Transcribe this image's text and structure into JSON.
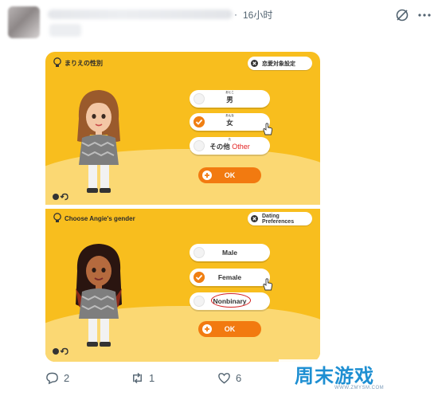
{
  "post": {
    "time_separator": "·",
    "time": "16小时"
  },
  "panel_top": {
    "title": "まりえの性別",
    "preferences_label": "恋愛対象設定",
    "options": [
      {
        "label": "男",
        "ruby": "おとこ",
        "selected": false
      },
      {
        "label": "女",
        "ruby": "おんな",
        "selected": true
      },
      {
        "label": "その他",
        "ruby": "た",
        "selected": false,
        "annotation": "Other"
      }
    ],
    "ok_label": "OK"
  },
  "panel_bottom": {
    "title": "Choose Angie's gender",
    "preferences_label": "Dating Preferences",
    "options": [
      {
        "label": "Male",
        "selected": false
      },
      {
        "label": "Female",
        "selected": true
      },
      {
        "label": "Nonbinary",
        "selected": false,
        "circled": true
      }
    ],
    "ok_label": "OK"
  },
  "actions": {
    "replies": "2",
    "reposts": "1",
    "likes": "6"
  },
  "watermark": {
    "text": "周末游戏",
    "sub": "WWW.ZMYSM.COM"
  },
  "colors": {
    "panel_bg": "#f8be1e",
    "accent_orange": "#f27a10",
    "annotation_red": "#e32222"
  },
  "icons": [
    "grok-icon",
    "more-icon",
    "bulb-icon",
    "close-icon",
    "check-icon",
    "hand-cursor-icon",
    "plus-icon",
    "reply-icon",
    "repost-icon",
    "like-icon"
  ]
}
